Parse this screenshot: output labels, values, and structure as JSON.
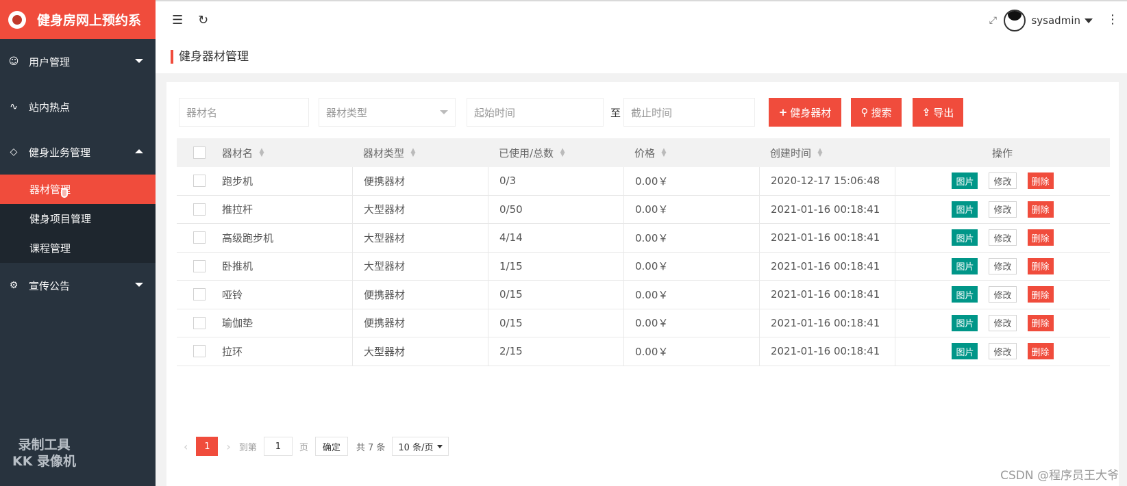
{
  "sidebar": {
    "logo_text": "健身房网上预约系",
    "items": [
      {
        "icon": "smile-icon",
        "glyph": "☺",
        "label": "用户管理",
        "caret": "down"
      },
      {
        "icon": "pulse-icon",
        "glyph": "∿",
        "label": "站内热点",
        "caret": ""
      },
      {
        "icon": "diamond-icon",
        "glyph": "◇",
        "label": "健身业务管理",
        "caret": "up"
      }
    ],
    "submenu": [
      {
        "label": "器材管理",
        "active": true
      },
      {
        "label": "健身项目管理",
        "active": false
      },
      {
        "label": "课程管理",
        "active": false
      }
    ],
    "after_items": [
      {
        "icon": "gear-icon",
        "glyph": "⚙",
        "label": "宣传公告",
        "caret": "down"
      }
    ],
    "watermark": [
      "录制工具",
      "KK 录像机"
    ]
  },
  "topbar": {
    "username": "sysadmin"
  },
  "page": {
    "title": "健身器材管理"
  },
  "filters": {
    "name_placeholder": "器材名",
    "type_placeholder": "器材类型",
    "start_placeholder": "起始时间",
    "to_label": "至",
    "end_placeholder": "截止时间",
    "add_label": "健身器材",
    "search_label": "搜索",
    "export_label": "导出"
  },
  "table": {
    "headers": [
      "器材名",
      "器材类型",
      "已使用/总数",
      "价格",
      "创建时间",
      "操作"
    ],
    "op_labels": [
      "图片",
      "修改",
      "删除"
    ],
    "rows": [
      [
        "跑步机",
        "便携器材",
        "0/3",
        "0.00￥",
        "2020-12-17 15:06:48"
      ],
      [
        "推拉杆",
        "大型器材",
        "0/50",
        "0.00￥",
        "2021-01-16 00:18:41"
      ],
      [
        "高级跑步机",
        "大型器材",
        "4/14",
        "0.00￥",
        "2021-01-16 00:18:41"
      ],
      [
        "卧推机",
        "大型器材",
        "1/15",
        "0.00￥",
        "2021-01-16 00:18:41"
      ],
      [
        "哑铃",
        "便携器材",
        "0/15",
        "0.00￥",
        "2021-01-16 00:18:41"
      ],
      [
        "瑜伽垫",
        "便携器材",
        "0/15",
        "0.00￥",
        "2021-01-16 00:18:41"
      ],
      [
        "拉环",
        "大型器材",
        "2/15",
        "0.00￥",
        "2021-01-16 00:18:41"
      ]
    ]
  },
  "pagination": {
    "current_page": "1",
    "goto_label": "到第",
    "goto_value": "1",
    "page_label": "页",
    "confirm_label": "确定",
    "total_label": "共 7 条",
    "page_size_label": "10 条/页"
  },
  "watermark_right": "CSDN @程序员王大爷"
}
